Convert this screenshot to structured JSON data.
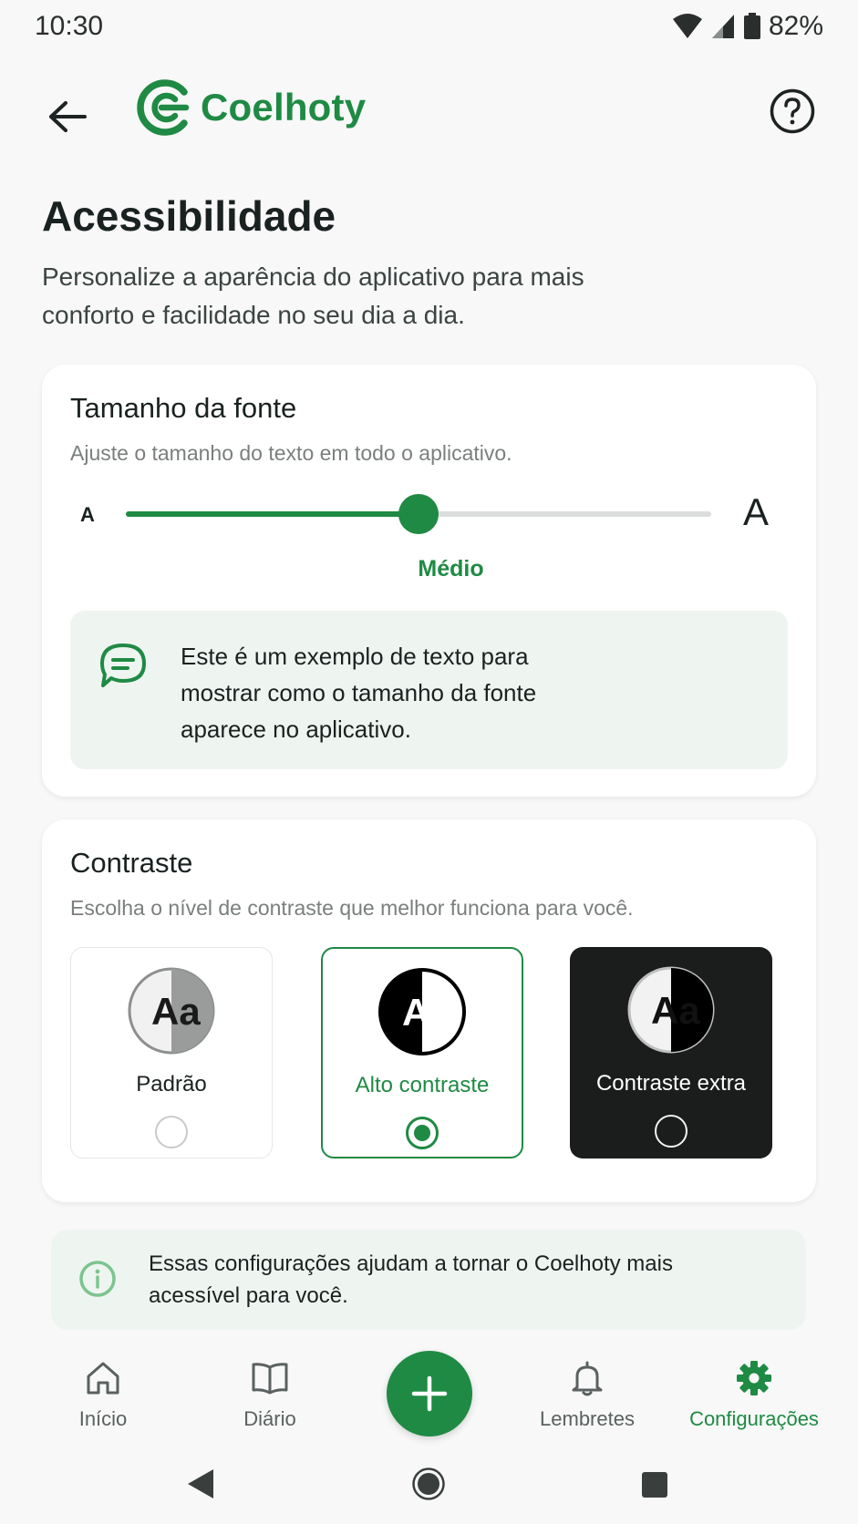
{
  "status_bar": {
    "time": "10:30",
    "battery": "82%",
    "icons": [
      "wifi-icon",
      "signal-icon",
      "battery-icon"
    ]
  },
  "header": {
    "app_name": "Coelhoty",
    "back_icon": "arrow-left-icon",
    "help_icon": "question-circle-icon",
    "brand_color": "#1f8a44"
  },
  "page": {
    "title": "Acessibilidade",
    "subtitle": "Personalize a aparência do aplicativo para mais conforto e facilidade no seu dia a dia."
  },
  "font_size": {
    "title": "Tamanho da fonte",
    "description": "Ajuste o tamanho do texto em todo o aplicativo.",
    "small_label": "A",
    "large_label": "A",
    "value_label": "Médio",
    "slider_level": 0.5,
    "preview_icon": "chat-bubble-icon",
    "preview_text": "Este é um exemplo de texto para mostrar como o tamanho da fonte aparece no aplicativo."
  },
  "contrast": {
    "title": "Contraste",
    "description": "Escolha o nível de contraste que melhor funciona para você.",
    "options": [
      {
        "label": "Padrão",
        "badge_text": "Aa",
        "selected": false
      },
      {
        "label": "Alto contraste",
        "badge_text": "Aa",
        "selected": true
      },
      {
        "label": "Contraste extra",
        "badge_text": "Aa",
        "selected": false
      }
    ]
  },
  "info": {
    "icon": "info-circle-icon",
    "text": "Essas configurações ajudam a tornar o Coelhoty mais acessível para você."
  },
  "bottom_nav": {
    "items": [
      {
        "label": "Início",
        "icon": "home-icon",
        "active": false
      },
      {
        "label": "Diário",
        "icon": "book-icon",
        "active": false
      },
      {
        "label": "Lembretes",
        "icon": "bell-icon",
        "active": false
      },
      {
        "label": "Configurações",
        "icon": "gear-icon",
        "active": true
      }
    ],
    "fab_icon": "plus-icon"
  },
  "system_nav": {
    "icons": [
      "triangle-back-icon",
      "circle-home-icon",
      "square-recents-icon"
    ]
  }
}
